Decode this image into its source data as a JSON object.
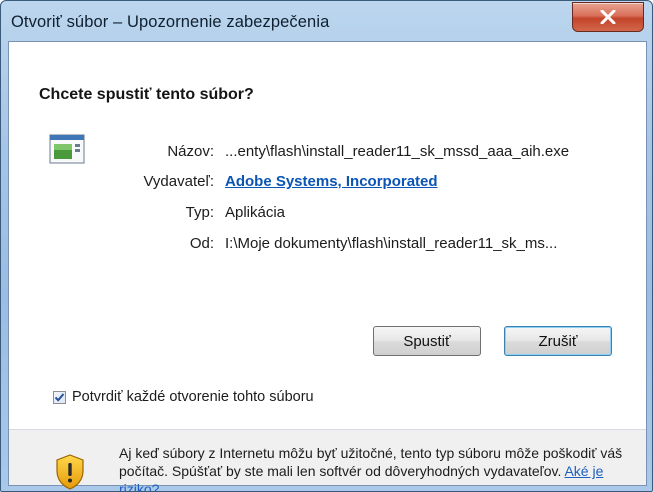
{
  "window": {
    "title": "Otvoriť súbor – Upozornenie zabezpečenia"
  },
  "dialog": {
    "question": "Chcete spustiť tento súbor?",
    "fields": {
      "name_label": "Názov:",
      "name_value": "...enty\\flash\\install_reader11_sk_mssd_aaa_aih.exe",
      "publisher_label": "Vydavateľ:",
      "publisher_value": "Adobe Systems, Incorporated",
      "type_label": "Typ:",
      "type_value": "Aplikácia",
      "from_label": "Od:",
      "from_value": "I:\\Moje dokumenty\\flash\\install_reader11_sk_ms..."
    },
    "buttons": {
      "run": "Spustiť",
      "cancel": "Zrušiť"
    },
    "checkbox": {
      "label": "Potvrdiť každé otvorenie tohto súboru",
      "checked": true
    },
    "warning": {
      "text": "Aj keď súbory z Internetu môžu byť užitočné, tento typ súboru môže poškodiť váš počítač. Spúšťať by ste mali len softvér od dôveryhodných vydavateľov.",
      "link": "Aké je riziko?"
    }
  },
  "icons": {
    "close": "close-icon",
    "app": "application-icon",
    "shield": "security-shield-icon",
    "check": "checkmark-icon"
  },
  "colors": {
    "titlebar": "#a6c4e6",
    "close_button": "#c2442b",
    "link": "#0a55b5",
    "footer_bg": "#f0f0f0"
  }
}
